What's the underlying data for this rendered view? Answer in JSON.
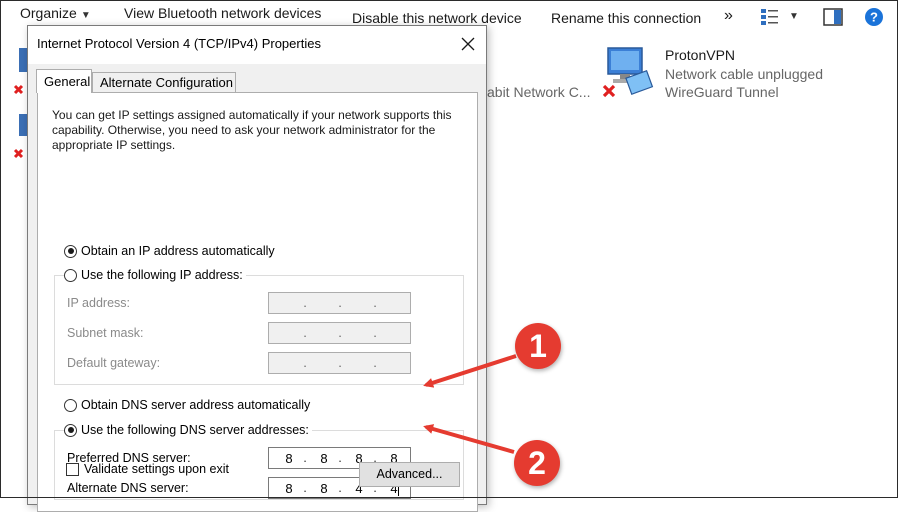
{
  "toolbar": {
    "organize": "Organize",
    "bluetooth": "View Bluetooth network devices",
    "disable": "Disable this network device",
    "rename": "Rename this connection",
    "more": "»"
  },
  "background": {
    "partial_adapter": "abit Network C...",
    "vpn": {
      "name": "ProtonVPN",
      "status": "Network cable unplugged",
      "type": "WireGuard Tunnel"
    }
  },
  "dialog": {
    "title": "Internet Protocol Version 4 (TCP/IPv4) Properties",
    "tabs": [
      "General",
      "Alternate Configuration"
    ],
    "intro": "You can get IP settings assigned automatically if your network supports this capability. Otherwise, you need to ask your network administrator for the appropriate IP settings.",
    "ip_auto": "Obtain an IP address automatically",
    "ip_manual": "Use the following IP address:",
    "ip_address_label": "IP address:",
    "subnet_label": "Subnet mask:",
    "gateway_label": "Default gateway:",
    "dns_auto": "Obtain DNS server address automatically",
    "dns_manual": "Use the following DNS server addresses:",
    "preferred_dns_label": "Preferred DNS server:",
    "alternate_dns_label": "Alternate DNS server:",
    "preferred_dns": [
      "8",
      "8",
      "8",
      "8"
    ],
    "alternate_dns": [
      "8",
      "8",
      "4",
      "4"
    ],
    "validate": "Validate settings upon exit",
    "advanced": "Advanced..."
  },
  "annotations": [
    "1",
    "2"
  ],
  "colors": {
    "callout": "#e53b30",
    "error_x": "#e02020"
  }
}
